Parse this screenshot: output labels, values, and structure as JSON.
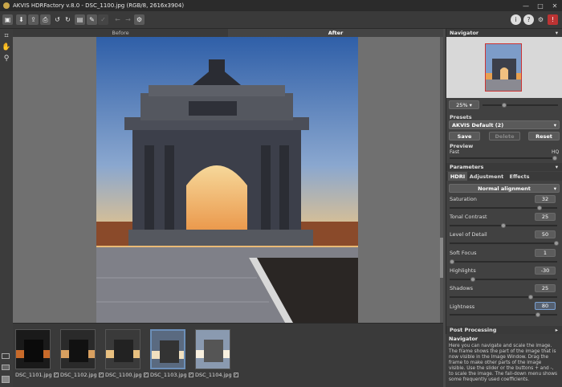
{
  "window": {
    "title": "AKVIS HDRFactory v.8.0 - DSC_1100.jpg (RGB/8, 2616x3904)",
    "minimize": "—",
    "maximize": "□",
    "close": "✕"
  },
  "toolbar": {
    "icons": [
      "open-icon",
      "save-icon",
      "export-icon",
      "print-icon",
      "undo-icon",
      "redo-icon",
      "batch-icon",
      "run-icon",
      "apply-icon",
      "back-icon",
      "forward-icon",
      "settings-icon"
    ],
    "right_icons": [
      "info-icon",
      "help-icon",
      "gear-icon",
      "notice-icon"
    ]
  },
  "image_tabs": {
    "before": "Before",
    "after": "After"
  },
  "filmstrip": {
    "items": [
      {
        "name": "DSC_1101.jpg"
      },
      {
        "name": "DSC_1102.jpg"
      },
      {
        "name": "DSC_1100.jpg"
      },
      {
        "name": "DSC_1103.jpg"
      },
      {
        "name": "DSC_1104.jpg"
      }
    ],
    "selected_index": 3
  },
  "navigator": {
    "title": "Navigator",
    "zoom": "25%"
  },
  "presets": {
    "title": "Presets",
    "selected": "AKVIS Default (2)",
    "save": "Save",
    "delete": "Delete",
    "reset": "Reset"
  },
  "preview": {
    "title": "Preview",
    "fast": "Fast",
    "hq": "HQ"
  },
  "parameters": {
    "title": "Parameters",
    "tabs": [
      "HDRI",
      "Adjustment",
      "Effects"
    ],
    "alignment": "Normal alignment",
    "items": [
      {
        "label": "Saturation",
        "value": "32"
      },
      {
        "label": "Tonal Contrast",
        "value": "25"
      },
      {
        "label": "Level of Detail",
        "value": "50"
      },
      {
        "label": "Soft Focus",
        "value": "1"
      },
      {
        "label": "Highlights",
        "value": "-30"
      },
      {
        "label": "Shadows",
        "value": "25"
      },
      {
        "label": "Lightness",
        "value": "80"
      }
    ]
  },
  "post_processing": {
    "title": "Post Processing"
  },
  "help": {
    "title": "Navigator",
    "text": "Here you can navigate and scale the image. The frame shows the part of the image that is now visible in the Image Window. Drag the frame to make other parts of the image visible. Use the slider or the buttons + and -, to scale the image. The fall-down menu shows some frequently used coefficients."
  }
}
